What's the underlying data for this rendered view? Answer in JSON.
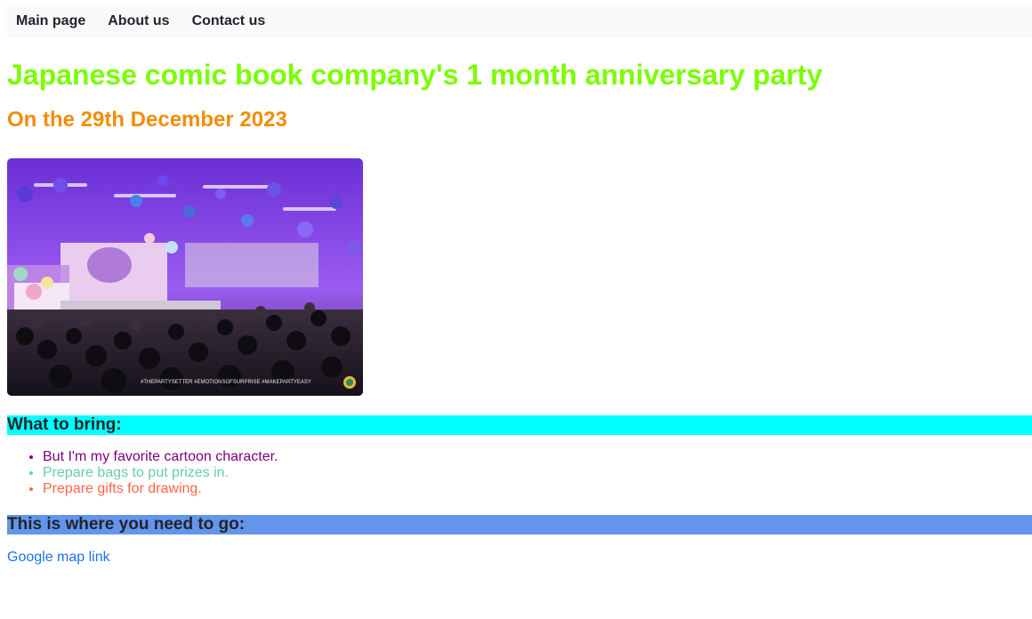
{
  "nav": {
    "items": [
      {
        "label": "Main page"
      },
      {
        "label": "About us"
      },
      {
        "label": "Contact us"
      }
    ]
  },
  "page": {
    "title": "Japanese comic book company's 1 month anniversary party",
    "subtitle": "On the 29th December 2023",
    "photo_caption_text": "#THEPARTYSETTER #EMOTIONSOFSURPRISE #MAKEPARTYEASY"
  },
  "bring": {
    "heading": "What to bring:",
    "items": [
      {
        "text": "But I'm my favorite cartoon character.",
        "color": "#800080"
      },
      {
        "text": "Prepare bags to put prizes in.",
        "color": "#66cdaa"
      },
      {
        "text": "Prepare gifts for drawing.",
        "color": "#ff6347"
      }
    ]
  },
  "directions": {
    "heading": "This is where you need to go:",
    "link_label": "Google map link"
  },
  "colors": {
    "title": "#7cfc00",
    "subtitle": "#f48c06",
    "bring_heading_bg": "#00ffff",
    "go_heading_bg": "#6495ed",
    "link": "#1a73e8",
    "navbar_bg": "#f8f9fa"
  }
}
